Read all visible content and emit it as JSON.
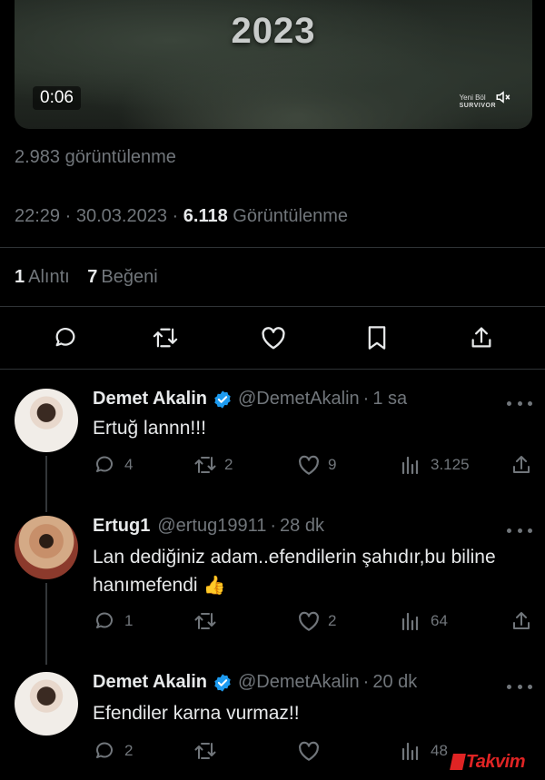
{
  "video": {
    "title_overlay": "2023",
    "duration": "0:06",
    "logo_line1": "Yeni Böl",
    "logo_line2": "SURVIVOR"
  },
  "post": {
    "views_label": "2.983 görüntülenme",
    "time": "22:29",
    "date": "30.03.2023",
    "separator": "·",
    "total_views": "6.118",
    "total_views_label": "Görüntülenme",
    "quotes_count": "1",
    "quotes_label": "Alıntı",
    "likes_count": "7",
    "likes_label": "Beğeni"
  },
  "replies": [
    {
      "name": "Demet Akalin",
      "verified": true,
      "handle": "@DemetAkalin",
      "time": "1 sa",
      "text": "Ertuğ lannn!!!",
      "replies": "4",
      "reposts": "2",
      "likes": "9",
      "views": "3.125"
    },
    {
      "name": "Ertug1",
      "verified": false,
      "handle": "@ertug19911",
      "time": "28 dk",
      "text": "Lan dediğiniz adam..efendilerin şahıdır,bu biline hanımefendi",
      "emoji": "👍",
      "replies": "1",
      "reposts": "",
      "likes": "2",
      "views": "64"
    },
    {
      "name": "Demet Akalin",
      "verified": true,
      "handle": "@DemetAkalin",
      "time": "20 dk",
      "text": "Efendiler karna vurmaz!!",
      "replies": "2",
      "reposts": "",
      "likes": "",
      "views": "48"
    }
  ],
  "watermark": "Takvim",
  "colors": {
    "background": "#000000",
    "text": "#e7e9ea",
    "muted": "#71767b",
    "verified": "#1d9bf0",
    "divider": "#2f3336",
    "watermark": "#ff2a2a"
  }
}
